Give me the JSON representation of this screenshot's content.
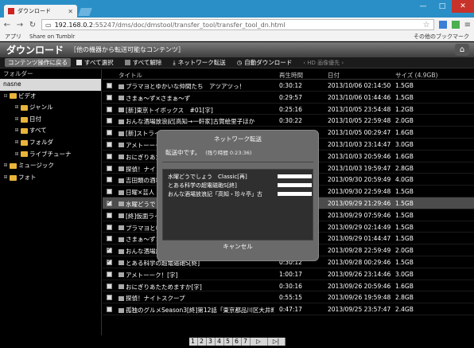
{
  "browser": {
    "tab_title": "ダウンロード",
    "url_host": "192.168.0.2",
    "url_path": ":55247/dms/doc/dmstool/transfer_tool/transfer_tool_dn.html",
    "bookmarks": [
      "アプリ",
      "Share on Tumblr"
    ],
    "other_bookmarks": "その他のブックマーク"
  },
  "app": {
    "title": "ダウンロード",
    "subtitle": "［他の機器から転送可能なコンテンツ］"
  },
  "actions": {
    "back": "コンテンツ操作に戻る",
    "select_all": "すべて選択",
    "deselect_all": "すべて解除",
    "network_transfer": "ネットワーク転送",
    "auto_download": "自動ダウンロード",
    "hd_priority": "‹ HD 画像優先 ›"
  },
  "sidebar": {
    "header": "フォルダー",
    "items": [
      {
        "label": "nasne",
        "level": 0,
        "toggle": "",
        "icon": false,
        "selected": true
      },
      {
        "label": "ビデオ",
        "level": 0,
        "toggle": "⊟",
        "icon": true,
        "selected": false
      },
      {
        "label": "ジャンル",
        "level": 1,
        "toggle": "⊞",
        "icon": true,
        "selected": false
      },
      {
        "label": "日付",
        "level": 1,
        "toggle": "⊞",
        "icon": true,
        "selected": false
      },
      {
        "label": "すべて",
        "level": 1,
        "toggle": "⊞",
        "icon": true,
        "selected": false
      },
      {
        "label": "フォルダ",
        "level": 1,
        "toggle": "⊞",
        "icon": true,
        "selected": false
      },
      {
        "label": "ライブチューナ",
        "level": 1,
        "toggle": "⊞",
        "icon": true,
        "selected": false
      },
      {
        "label": "ミュージック",
        "level": 0,
        "toggle": "⊞",
        "icon": true,
        "selected": false
      },
      {
        "label": "フォト",
        "level": 0,
        "toggle": "⊞",
        "icon": true,
        "selected": false
      }
    ]
  },
  "list": {
    "headers": {
      "title": "タイトル",
      "time": "再生時間",
      "date": "日付",
      "size": "サイズ (4.9GB)"
    },
    "rows": [
      {
        "title": "プラマヨとゆかいな仲間たち　アツアツっ！",
        "time": "0:30:12",
        "date": "2013/10/06 02:14:50",
        "size": "1.5GB",
        "checked": false
      },
      {
        "title": "さまぁ～ず×さまぁ～ず",
        "time": "0:29:57",
        "date": "2013/10/06 01:44:46",
        "size": "1.5GB",
        "checked": false
      },
      {
        "title": "[新]東京トイボックス　#01[字]",
        "time": "0:25:16",
        "date": "2013/10/05 23:54:48",
        "size": "1.2GB",
        "checked": false
      },
      {
        "title": "おんな酒場放浪記[高知→一軒家]古賀絵里子ほか",
        "time": "0:30:22",
        "date": "2013/10/05 22:59:48",
        "size": "2.0GB",
        "checked": false
      },
      {
        "title": "[新]ストライク・ザ・ブラッド",
        "time": "0:30:16",
        "date": "2013/10/05 00:29:47",
        "size": "1.6GB",
        "checked": false
      },
      {
        "title": "アメトーーーク",
        "time": "0:50:25",
        "date": "2013/10/03 23:14:47",
        "size": "3.0GB",
        "checked": false
      },
      {
        "title": "おにぎりあたためますか",
        "time": "0:30:16",
        "date": "2013/10/03 20:59:46",
        "size": "1.6GB",
        "checked": false
      },
      {
        "title": "探偵！ナイトスクープ",
        "time": "0:55:15",
        "date": "2013/10/03 19:59:47",
        "size": "2.8GB",
        "checked": false
      },
      {
        "title": "吉田類の酒場放浪記",
        "time": "0:30:22",
        "date": "2013/09/30 20:59:49",
        "size": "4.0GB",
        "checked": false
      },
      {
        "title": "日曜×芸人",
        "time": "0:30:12",
        "date": "2013/09/30 22:59:48",
        "size": "1.5GB",
        "checked": false
      },
      {
        "title": "水曜どうでしょう　Classic[再]",
        "time": "0:30:12",
        "date": "2013/09/29 21:29:46",
        "size": "1.5GB",
        "checked": true,
        "selected": true
      },
      {
        "title": "[終]仮面ライダー",
        "time": "0:30:12",
        "date": "2013/09/29 07:59:46",
        "size": "1.5GB",
        "checked": false
      },
      {
        "title": "プラマヨとゆかいな仲間たち",
        "time": "0:30:12",
        "date": "2013/09/29 02:14:49",
        "size": "1.5GB",
        "checked": false
      },
      {
        "title": "さまぁ～ず×さまぁ～ず",
        "time": "0:30:12",
        "date": "2013/09/29 01:44:47",
        "size": "1.5GB",
        "checked": false
      },
      {
        "title": "おんな酒場放浪記「高知・珍々亭」",
        "time": "0:30:12",
        "date": "2013/09/28 22:59:49",
        "size": "2.0GB",
        "checked": true
      },
      {
        "title": "とある科学の超電磁砲S[終]",
        "time": "0:30:12",
        "date": "2013/09/28 00:29:46",
        "size": "1.5GB",
        "checked": true
      },
      {
        "title": "アメトーーク！[字]",
        "time": "1:00:17",
        "date": "2013/09/26 23:14:46",
        "size": "3.0GB",
        "checked": false
      },
      {
        "title": "おにぎりあたためますか[字]",
        "time": "0:30:16",
        "date": "2013/09/26 20:59:46",
        "size": "1.6GB",
        "checked": false
      },
      {
        "title": "探偵！ナイトスクープ",
        "time": "0:55:15",
        "date": "2013/09/26 19:59:48",
        "size": "2.8GB",
        "checked": false
      },
      {
        "title": "孤独のグルメSeason3[終]第12話「東京都品川区大井町…」",
        "time": "0:47:17",
        "date": "2013/09/25 23:57:47",
        "size": "2.4GB",
        "checked": false
      }
    ]
  },
  "pager": {
    "pages": [
      "1",
      "2",
      "3",
      "4",
      "5",
      "6",
      "7"
    ],
    "next": "▷",
    "last": "▷|"
  },
  "modal": {
    "title": "ネットワーク転送",
    "status": "転送中です。",
    "remaining": "(残り時間 0:23:36)",
    "items": [
      {
        "label": "水曜どうでしょう　Classic[再]",
        "progress": 1.0
      },
      {
        "label": "とある科学の超電磁砲S[終]",
        "progress": 1.0
      },
      {
        "label": "おんな酒場放浪記「高知・珍々亭」古",
        "progress": 1.0
      }
    ],
    "cancel": "キャンセル"
  },
  "colors": {
    "chrome_blue": "#2b8fc7",
    "folder_yellow": "#e8b43a",
    "row_selected": "#4c4c4c"
  }
}
